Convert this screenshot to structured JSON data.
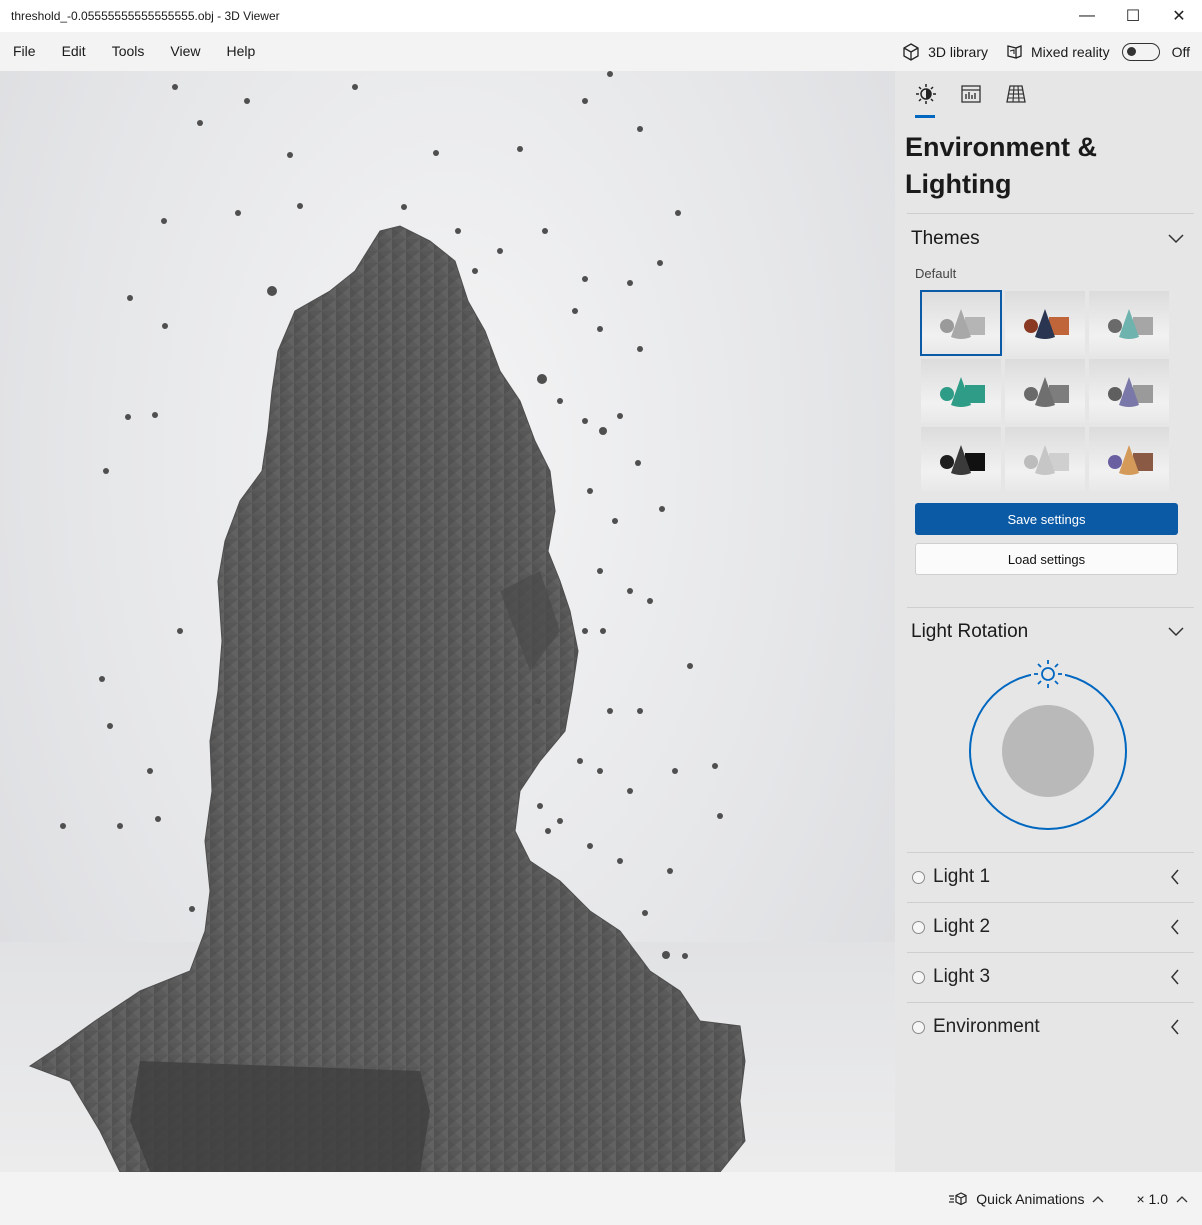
{
  "window": {
    "title": "threshold_-0.05555555555555555.obj - 3D Viewer",
    "minimize_glyph": "—",
    "maximize_glyph": "☐",
    "close_glyph": "✕"
  },
  "menu": {
    "items": [
      "File",
      "Edit",
      "Tools",
      "View",
      "Help"
    ],
    "library_label": "3D library",
    "mixed_reality_label": "Mixed reality",
    "toggle_state": "Off"
  },
  "panel": {
    "title": "Environment & Lighting",
    "tabs": [
      "environment-lighting",
      "stats",
      "grid"
    ],
    "themes": {
      "header": "Themes",
      "sublabel": "Default",
      "save_label": "Save settings",
      "load_label": "Load settings",
      "swatches": [
        {
          "cone": "#a8a8a8",
          "cube": "#b5b5b5",
          "sphere": "#9a9a9a"
        },
        {
          "cone": "#2a3552",
          "cube": "#c0643a",
          "sphere": "#8a3a22"
        },
        {
          "cone": "#6fb3ae",
          "cube": "#a6a6a6",
          "sphere": "#6a6a6a"
        },
        {
          "cone": "#2e9c86",
          "cube": "#2e9c86",
          "sphere": "#2e9c86"
        },
        {
          "cone": "#6f6f6f",
          "cube": "#7d7d7d",
          "sphere": "#6a6a6a"
        },
        {
          "cone": "#7a78a8",
          "cube": "#9a9a9a",
          "sphere": "#5f5f5f"
        },
        {
          "cone": "#3a3a3a",
          "cube": "#111111",
          "sphere": "#1e1e1e"
        },
        {
          "cone": "#c6c6c6",
          "cube": "#cfcfcf",
          "sphere": "#bcbcbc"
        },
        {
          "cone": "#d49a5a",
          "cube": "#8a5a44",
          "sphere": "#6a5fa0"
        }
      ]
    },
    "light_rotation": {
      "header": "Light Rotation"
    },
    "lights": [
      "Light 1",
      "Light 2",
      "Light 3",
      "Environment"
    ],
    "accent": "#0067c0"
  },
  "status": {
    "quick_animations": "Quick Animations",
    "zoom": "× 1.0"
  }
}
